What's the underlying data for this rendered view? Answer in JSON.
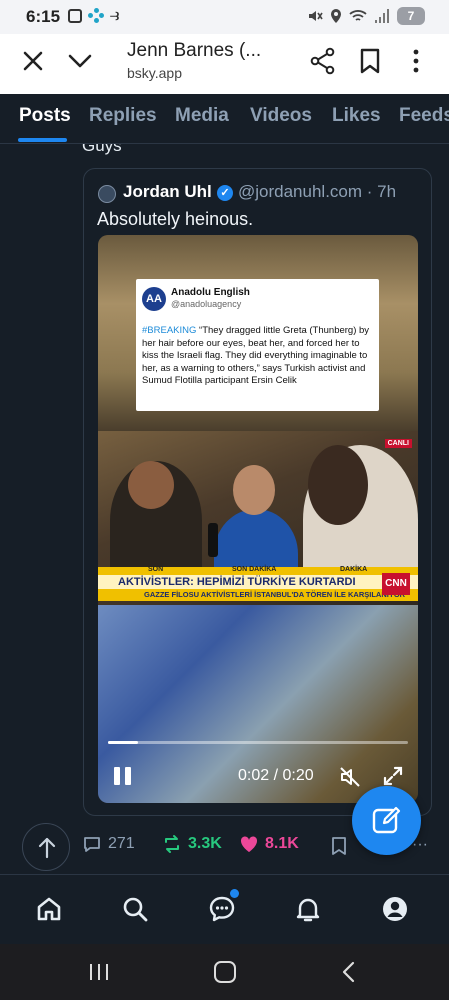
{
  "status_bar": {
    "time": "6:15",
    "battery": "7"
  },
  "browser": {
    "title": "Jenn Barnes (...",
    "url": "bsky.app"
  },
  "tabs": [
    {
      "label": "Posts",
      "active": true
    },
    {
      "label": "Replies"
    },
    {
      "label": "Media"
    },
    {
      "label": "Videos"
    },
    {
      "label": "Likes"
    },
    {
      "label": "Feeds"
    }
  ],
  "feed": {
    "prev_text": "Guys",
    "quote": {
      "name": "Jordan Uhl",
      "handle": "@jordanuhl.com · 7h",
      "text": "Absolutely heinous.",
      "video": {
        "embedded_tweet": {
          "logo": "AA",
          "name": "Anadolu English",
          "handle": "@anadoluagency",
          "hashtag": "#BREAKING",
          "text": " “They dragged little Greta (Thunberg) by her hair before our eyes, beat her, and forced her to kiss the Israeli flag. They did everything imaginable to her, as a warning to others,” says Turkish activist and Sumud Flotilla participant Ersin Celik"
        },
        "news": {
          "live": "CANLI",
          "strip_1": "SON",
          "strip_2": "SON DAKİKA",
          "strip_3": "DAKİKA",
          "headline": "AKTİVİSTLER: HEPİMİZİ TÜRKİYE KURTARDI",
          "subline": "GAZZE FİLOSU AKTİVİSTLERİ İSTANBUL'DA TÖREN İLE KARŞILANIYOR",
          "channel": "CNN"
        },
        "time": "0:02 / 0:20",
        "progress": 0.1
      }
    }
  },
  "actions": {
    "replies": "271",
    "reposts": "3.3K",
    "likes": "8.1K"
  },
  "colors": {
    "accent": "#1e87f0",
    "repost": "#27c87e",
    "like": "#ec4899",
    "bg": "#161e27"
  }
}
